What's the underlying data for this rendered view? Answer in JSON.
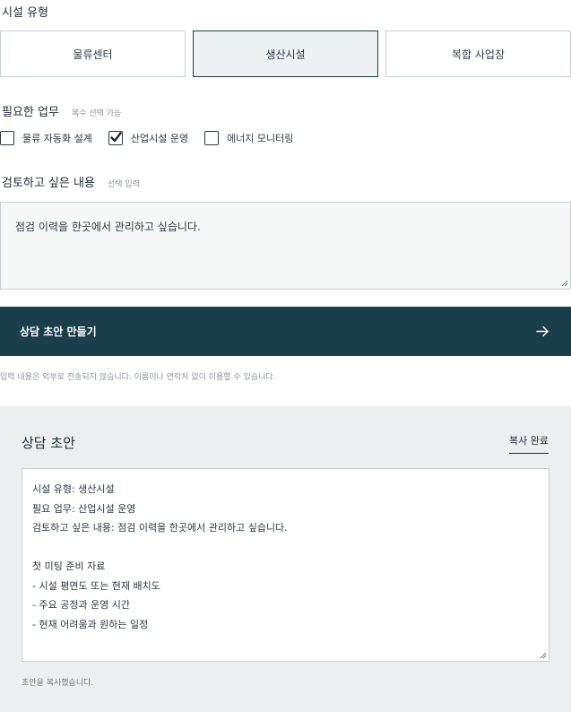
{
  "facility": {
    "label": "시설 유형",
    "options": [
      "물류센터",
      "생산시설",
      "복합 사업장"
    ],
    "selected": "생산시설"
  },
  "tasks": {
    "label": "필요한 업무",
    "hint": "복수 선택 가능",
    "items": [
      {
        "label": "물류 자동화 설계",
        "checked": false
      },
      {
        "label": "산업시설 운영",
        "checked": true
      },
      {
        "label": "에너지 모니터링",
        "checked": false
      }
    ]
  },
  "review": {
    "label": "검토하고 싶은 내용",
    "hint": "선택 입력",
    "value": "점검 이력을 한곳에서 관리하고 싶습니다."
  },
  "cta": {
    "label": "상담 초안 만들기",
    "icon": "arrow-right-icon"
  },
  "notice": "입력 내용은 외부로 전송되지 않습니다. 이름이나 연락처 없이 이용할 수 있습니다.",
  "draft": {
    "title": "상담 초안",
    "copy_label": "복사 완료",
    "lines": [
      "시설 유형: 생산시설",
      "필요 업무: 산업시설 운영",
      "검토하고 싶은 내용: 점검 이력을 한곳에서 관리하고 싶습니다.",
      "",
      "첫 미팅 준비 자료",
      "- 시설 평면도 또는 현재 배치도",
      "- 주요 공정과 운영 시간",
      "- 현재 어려움과 원하는 일정"
    ],
    "status": "초안을 복사했습니다."
  },
  "colors": {
    "primary": "#1b3e4b",
    "panel": "#eceff0",
    "border": "#c9d0d4"
  }
}
